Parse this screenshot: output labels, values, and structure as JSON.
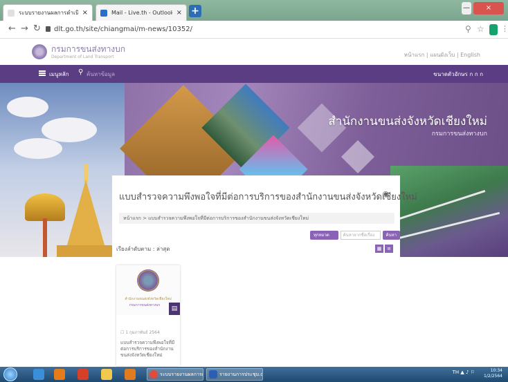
{
  "browser": {
    "tabs": [
      {
        "title": "ระบบรายงานผลการดำเนินงาน",
        "favicon_color": "#e0e0e0"
      },
      {
        "title": "Mail - Live.th - Outlook",
        "favicon_color": "#2a6fc9"
      }
    ],
    "new_tab_label": "+",
    "tab_close": "×",
    "url": "dlt.go.th/site/chiangmai/m-news/10352/",
    "win_min": "—",
    "win_close": "×",
    "zoom_icon": "⚲",
    "star_icon": "☆",
    "menu_icon": "⋮"
  },
  "site": {
    "name": "กรมการขนส่งทางบก",
    "subtitle": "Department of Land Transport",
    "top_links": "หน้าแรก | แผนผังเว็บ | English"
  },
  "navbar": {
    "menu_label": "เมนูหลัก",
    "search_placeholder": "ค้นหาข้อมูล",
    "right_label": "ขนาดตัวอักษร ก ก ก"
  },
  "banner": {
    "title": "สำนักงานขนส่งจังหวัดเชียงใหม่",
    "subtitle": "กรมการขนส่งทางบก"
  },
  "content": {
    "page_title": "แบบสำรวจความพึงพอใจที่มีต่อการบริการของสำนักงานขนส่งจังหวัดเชียงใหม่",
    "rss_icon": "◉",
    "breadcrumb": "หน้าแรก  >  แบบสำรวจความพึงพอใจที่มีต่อการบริการของสำนักงานขนส่งจังหวัดเชียงใหม่",
    "filter_button": "ทุกหมวดหมู่",
    "search_placeholder": "ค้นหาจากชื่อเรื่อง",
    "search_button": "ค้นหา",
    "sort_label": "เรียงลำดับตาม : ล่าสุด",
    "view_grid": "▦",
    "view_list": "≡",
    "card": {
      "caption_line1": "สำนักงานขนส่งจังหวัดเชียงใหม่",
      "caption_line2": "กรมการขนส่งทางบก",
      "doc_icon": "▤",
      "date": "☐ 1 กุมภาพันธ์ 2564",
      "text": "แบบสำรวจความพึงพอใจที่มีต่อการบริการของสำนักงานขนส่งจังหวัดเชียงใหม่"
    }
  },
  "taskbar": {
    "tasks": [
      "ระบบรายงานผลการดำเนินงาน",
      "รายงานการประชุม.docx"
    ],
    "tray": "TH  ▲  ♪  ⚐",
    "time": "10:34",
    "date": "1/2/2564"
  }
}
